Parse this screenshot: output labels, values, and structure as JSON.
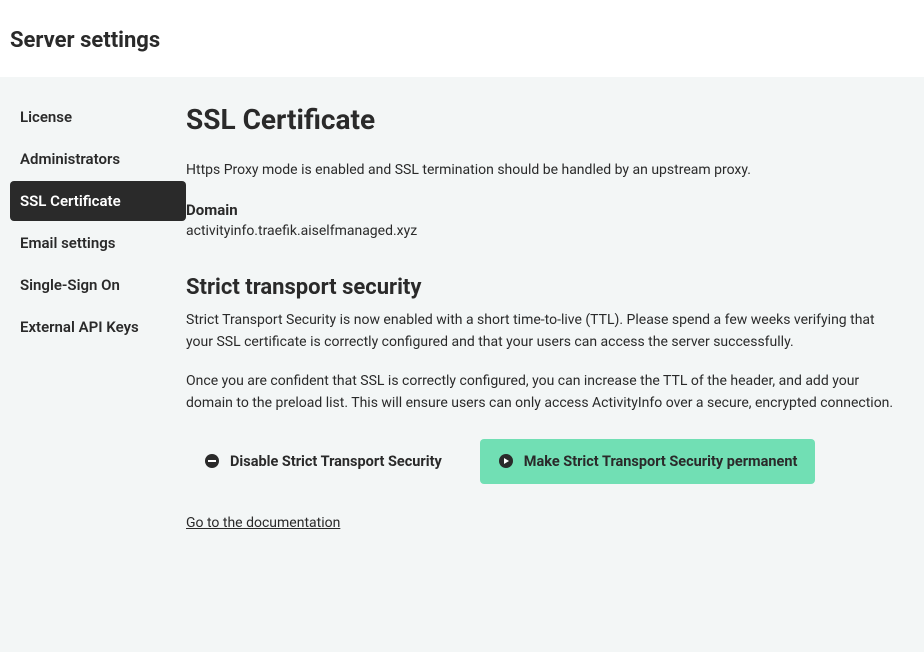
{
  "header": {
    "title": "Server settings"
  },
  "sidebar": {
    "items": [
      {
        "label": "License",
        "active": false
      },
      {
        "label": "Administrators",
        "active": false
      },
      {
        "label": "SSL Certificate",
        "active": true
      },
      {
        "label": "Email settings",
        "active": false
      },
      {
        "label": "Single-Sign On",
        "active": false
      },
      {
        "label": "External API Keys",
        "active": false
      }
    ]
  },
  "main": {
    "title": "SSL Certificate",
    "description": "Https Proxy mode is enabled and SSL termination should be handled by an upstream proxy.",
    "domain_label": "Domain",
    "domain_value": "activityinfo.traefik.aiselfmanaged.xyz",
    "section_title": "Strict transport security",
    "section_p1": "Strict Transport Security is now enabled with a short time-to-live (TTL). Please spend a few weeks verifying that your SSL certificate is correctly configured and that your users can access the server successfully.",
    "section_p2": "Once you are confident that SSL is correctly configured, you can increase the TTL of the header, and add your domain to the preload list. This will ensure users can only access ActivityInfo over a secure, encrypted connection.",
    "disable_button": "Disable Strict Transport Security",
    "permanent_button": "Make Strict Transport Security permanent",
    "doc_link": "Go to the documentation"
  }
}
